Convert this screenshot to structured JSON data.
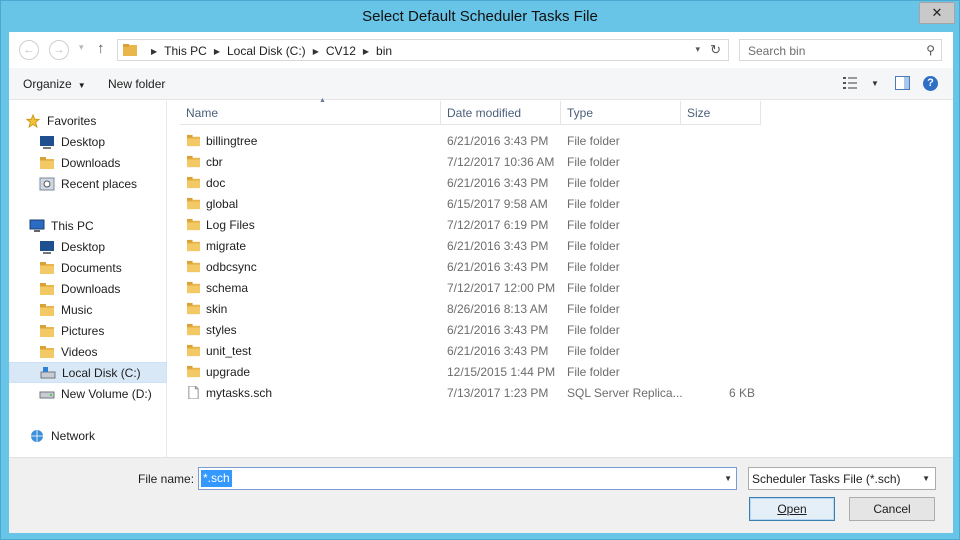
{
  "window": {
    "title": "Select Default Scheduler Tasks File",
    "close_glyph": "✕"
  },
  "nav": {
    "back_glyph": "←",
    "forward_glyph": "→",
    "dropdown_glyph": "▾",
    "up_glyph": "↑",
    "breadcrumb": [
      "This PC",
      "Local Disk (C:)",
      "CV12",
      "bin"
    ],
    "crumb_sep": "▶",
    "refresh_glyph": "↻"
  },
  "search": {
    "placeholder": "Search bin",
    "icon": "⚲"
  },
  "toolbar": {
    "organize_label": "Organize",
    "new_folder_label": "New folder",
    "caret": "▼"
  },
  "navpane": {
    "favorites": {
      "label": "Favorites",
      "items": [
        "Desktop",
        "Downloads",
        "Recent places"
      ]
    },
    "this_pc": {
      "label": "This PC",
      "items": [
        "Desktop",
        "Documents",
        "Downloads",
        "Music",
        "Pictures",
        "Videos",
        "Local Disk (C:)",
        "New Volume (D:)"
      ]
    },
    "network": {
      "label": "Network"
    },
    "selected": "Local Disk (C:)"
  },
  "columns": {
    "name": "Name",
    "date": "Date modified",
    "type": "Type",
    "size": "Size",
    "sort_glyph": "▲"
  },
  "files": [
    {
      "name": "billingtree",
      "date": "6/21/2016 3:43 PM",
      "type": "File folder",
      "size": "",
      "kind": "folder"
    },
    {
      "name": "cbr",
      "date": "7/12/2017 10:36 AM",
      "type": "File folder",
      "size": "",
      "kind": "folder"
    },
    {
      "name": "doc",
      "date": "6/21/2016 3:43 PM",
      "type": "File folder",
      "size": "",
      "kind": "folder"
    },
    {
      "name": "global",
      "date": "6/15/2017 9:58 AM",
      "type": "File folder",
      "size": "",
      "kind": "folder"
    },
    {
      "name": "Log Files",
      "date": "7/12/2017 6:19 PM",
      "type": "File folder",
      "size": "",
      "kind": "folder"
    },
    {
      "name": "migrate",
      "date": "6/21/2016 3:43 PM",
      "type": "File folder",
      "size": "",
      "kind": "folder"
    },
    {
      "name": "odbcsync",
      "date": "6/21/2016 3:43 PM",
      "type": "File folder",
      "size": "",
      "kind": "folder"
    },
    {
      "name": "schema",
      "date": "7/12/2017 12:00 PM",
      "type": "File folder",
      "size": "",
      "kind": "folder"
    },
    {
      "name": "skin",
      "date": "8/26/2016 8:13 AM",
      "type": "File folder",
      "size": "",
      "kind": "folder"
    },
    {
      "name": "styles",
      "date": "6/21/2016 3:43 PM",
      "type": "File folder",
      "size": "",
      "kind": "folder"
    },
    {
      "name": "unit_test",
      "date": "6/21/2016 3:43 PM",
      "type": "File folder",
      "size": "",
      "kind": "folder"
    },
    {
      "name": "upgrade",
      "date": "12/15/2015 1:44 PM",
      "type": "File folder",
      "size": "",
      "kind": "folder"
    },
    {
      "name": "mytasks.sch",
      "date": "7/13/2017 1:23 PM",
      "type": "SQL Server Replica...",
      "size": "6 KB",
      "kind": "file"
    }
  ],
  "footer": {
    "file_name_label": "File name:",
    "file_name_value": "*.sch",
    "file_type_value": "Scheduler Tasks File (*.sch)",
    "dropdown_glyph": "▼",
    "open_label": "Open",
    "cancel_label": "Cancel"
  },
  "colors": {
    "title_bar": "#69c5e8",
    "folder": "#e8b64a",
    "selection": "#3399ff"
  }
}
